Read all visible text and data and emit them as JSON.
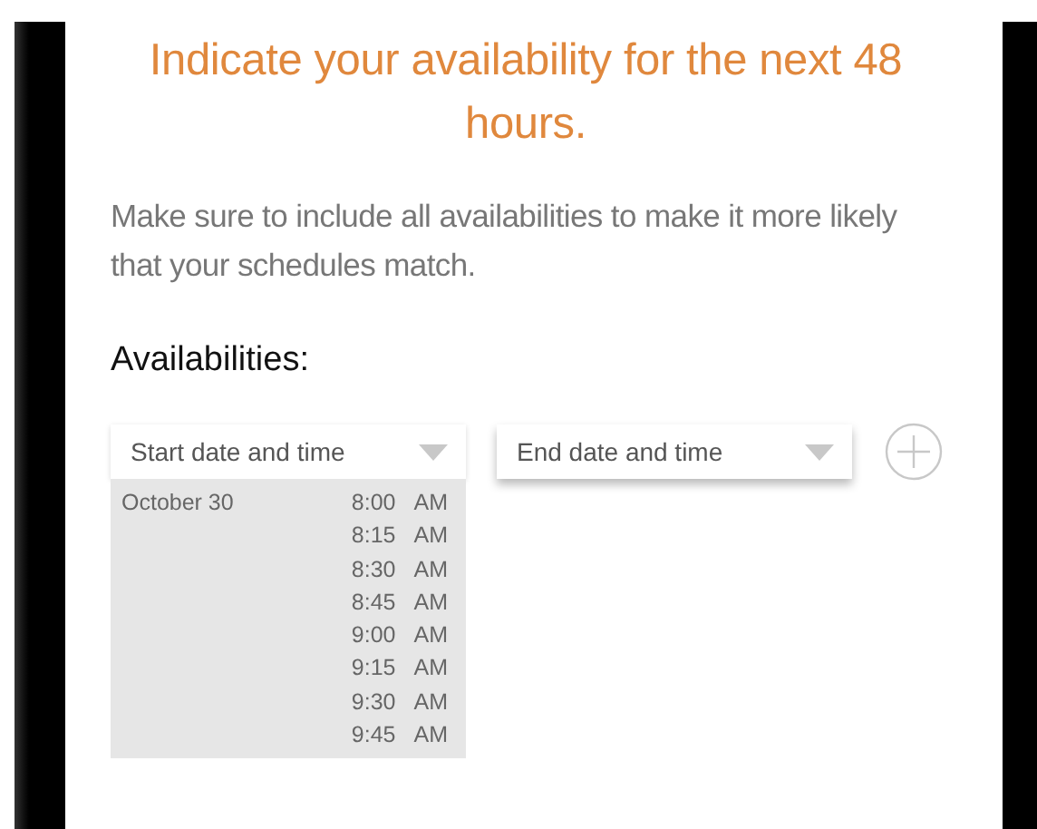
{
  "heading": "Indicate your availability for the next 48 hours.",
  "intro": "Make sure to include all availabilities to make it more likely that your schedules match.",
  "section_label": "Availabilities:",
  "pickers": [
    {
      "label": "Start date and time",
      "expanded": true,
      "date": "October 30",
      "times": [
        {
          "time": "8:00",
          "period": "AM"
        },
        {
          "time": "8:15",
          "period": "AM"
        },
        {
          "time": "8:30",
          "period": "AM"
        },
        {
          "time": "8:45",
          "period": "AM"
        },
        {
          "time": "9:00",
          "period": "AM"
        },
        {
          "time": "9:15",
          "period": "AM"
        },
        {
          "time": "9:30",
          "period": "AM"
        },
        {
          "time": "9:45",
          "period": "AM"
        }
      ]
    },
    {
      "label": "End date and time",
      "expanded": false
    }
  ]
}
